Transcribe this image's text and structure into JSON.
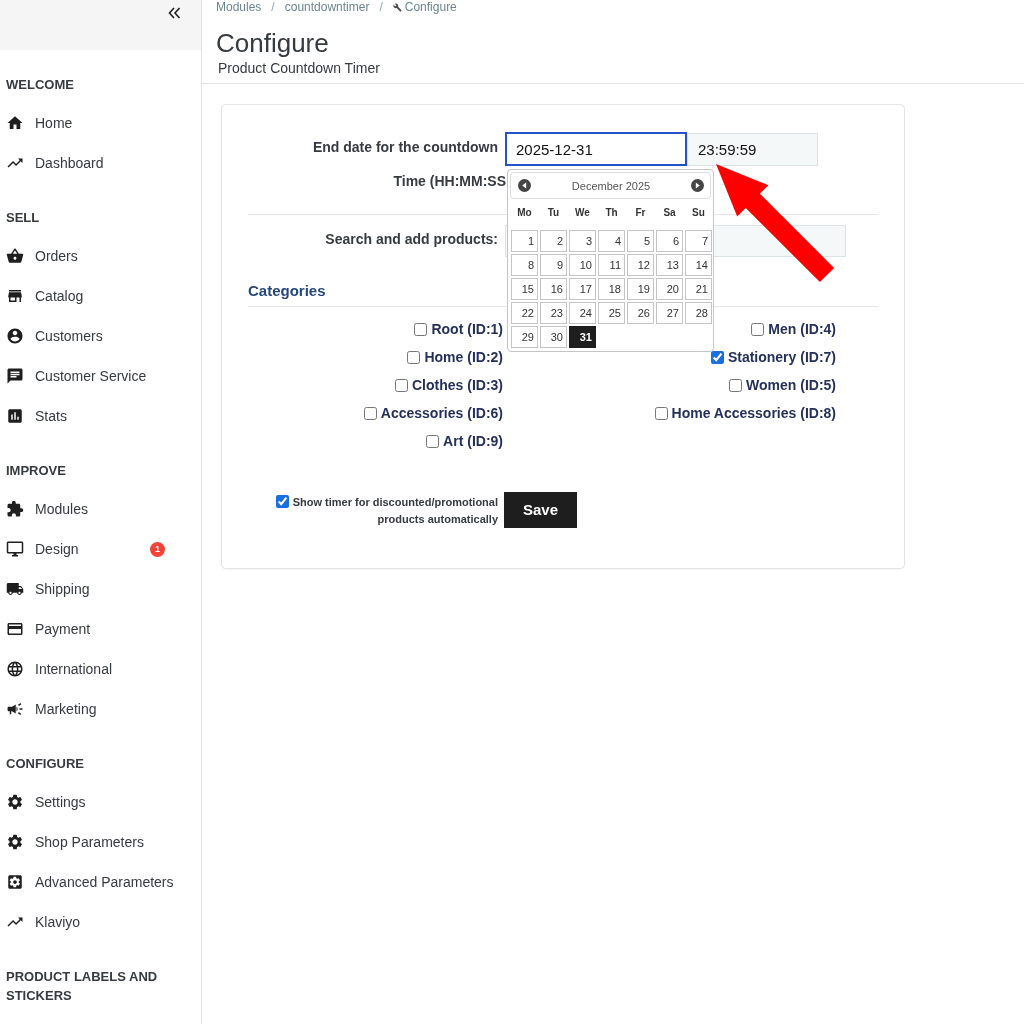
{
  "sidebar": {
    "sections": [
      {
        "heading": "WELCOME",
        "items": [
          {
            "label": "Home"
          },
          {
            "label": "Dashboard"
          }
        ]
      },
      {
        "heading": "SELL",
        "items": [
          {
            "label": "Orders"
          },
          {
            "label": "Catalog"
          },
          {
            "label": "Customers"
          },
          {
            "label": "Customer Service"
          },
          {
            "label": "Stats"
          }
        ]
      },
      {
        "heading": "IMPROVE",
        "items": [
          {
            "label": "Modules"
          },
          {
            "label": "Design",
            "badge": "1"
          },
          {
            "label": "Shipping"
          },
          {
            "label": "Payment"
          },
          {
            "label": "International"
          },
          {
            "label": "Marketing"
          }
        ]
      },
      {
        "heading": "CONFIGURE",
        "items": [
          {
            "label": "Settings"
          },
          {
            "label": "Shop Parameters"
          },
          {
            "label": "Advanced Parameters"
          },
          {
            "label": "Klaviyo"
          }
        ]
      },
      {
        "heading": "PRODUCT LABELS AND STICKERS"
      }
    ]
  },
  "breadcrumb": [
    {
      "label": "Modules",
      "separator": "/"
    },
    {
      "label": "countdowntimer",
      "separator": "/"
    },
    {
      "label": "Configure"
    }
  ],
  "page_header": {
    "title": "Configure",
    "subtitle": "Product Countdown Timer"
  },
  "form": {
    "end_date_label": "End date for the countdown",
    "date_field": {
      "value": "2025-12-31",
      "focused": true
    },
    "time_field": {
      "value": "23:59:59"
    },
    "time_label": "Time (HH:MM:SS",
    "search_label": "Search and add products:",
    "categories_heading": "Categories",
    "categories": [
      {
        "label": "Root (ID:1)",
        "checked": false
      },
      {
        "label": "Men (ID:4)",
        "checked": false
      },
      {
        "label": "Home (ID:2)",
        "checked": false
      },
      {
        "label": "Stationery (ID:7)",
        "checked": true
      },
      {
        "label": "Clothes (ID:3)",
        "checked": false
      },
      {
        "label": "Women (ID:5)",
        "checked": false
      },
      {
        "label": "Accessories (ID:6)",
        "checked": false
      },
      {
        "label": "Home Accessories (ID:8)",
        "checked": false
      },
      {
        "label": "Art (ID:9)",
        "checked": false
      }
    ],
    "auto_timer": {
      "label": "Show timer for discounted/promotional products automatically",
      "checked": true
    },
    "save_button": "Save"
  },
  "datepicker": {
    "month_label": "December 2025",
    "weekdays": [
      "Mo",
      "Tu",
      "We",
      "Th",
      "Fr",
      "Sa",
      "Su"
    ],
    "days": [
      {
        "label": "1",
        "selected": false
      },
      {
        "label": "2",
        "selected": false
      },
      {
        "label": "3",
        "selected": false
      },
      {
        "label": "4",
        "selected": false
      },
      {
        "label": "5",
        "selected": false
      },
      {
        "label": "6",
        "selected": false
      },
      {
        "label": "7",
        "selected": false
      },
      {
        "label": "8",
        "selected": false
      },
      {
        "label": "9",
        "selected": false
      },
      {
        "label": "10",
        "selected": false
      },
      {
        "label": "11",
        "selected": false
      },
      {
        "label": "12",
        "selected": false
      },
      {
        "label": "13",
        "selected": false
      },
      {
        "label": "14",
        "selected": false
      },
      {
        "label": "15",
        "selected": false
      },
      {
        "label": "16",
        "selected": false
      },
      {
        "label": "17",
        "selected": false
      },
      {
        "label": "18",
        "selected": false
      },
      {
        "label": "19",
        "selected": false
      },
      {
        "label": "20",
        "selected": false
      },
      {
        "label": "21",
        "selected": false
      },
      {
        "label": "22",
        "selected": false
      },
      {
        "label": "23",
        "selected": false
      },
      {
        "label": "24",
        "selected": false
      },
      {
        "label": "25",
        "selected": false
      },
      {
        "label": "26",
        "selected": false
      },
      {
        "label": "27",
        "selected": false
      },
      {
        "label": "28",
        "selected": false
      },
      {
        "label": "29",
        "selected": false
      },
      {
        "label": "30",
        "selected": false
      },
      {
        "label": "31",
        "selected": true
      }
    ]
  }
}
